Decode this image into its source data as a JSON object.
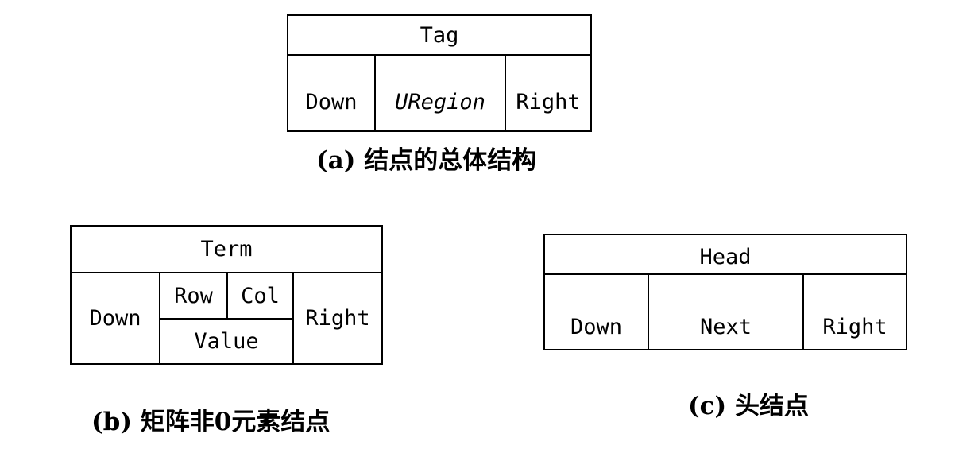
{
  "node_a": {
    "header": "Tag",
    "down": "Down",
    "middle": "URegion",
    "right": "Right",
    "caption": "(a) 结点的总体结构"
  },
  "node_b": {
    "header": "Term",
    "down": "Down",
    "row": "Row",
    "col": "Col",
    "value": "Value",
    "right": "Right",
    "caption": "(b) 矩阵非0元素结点"
  },
  "node_c": {
    "header": "Head",
    "down": "Down",
    "middle": "Next",
    "right": "Right",
    "caption": "(c) 头结点"
  }
}
